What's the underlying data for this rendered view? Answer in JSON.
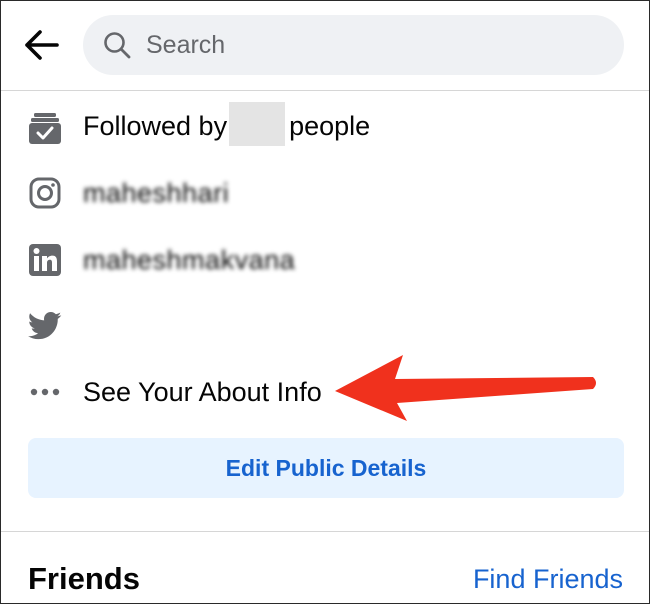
{
  "header": {
    "back_icon": "arrow-left-icon",
    "search": {
      "icon": "search-icon",
      "placeholder": "Search",
      "value": ""
    }
  },
  "info": {
    "followed": {
      "icon": "followers-check-icon",
      "prefix": "Followed by",
      "suffix": "people"
    },
    "instagram": {
      "icon": "instagram-icon",
      "handle": "maheshhari"
    },
    "linkedin": {
      "icon": "linkedin-icon",
      "handle": "maheshmakvana"
    },
    "twitter": {
      "icon": "twitter-icon"
    },
    "about": {
      "icon": "more-dots-icon",
      "label": "See Your About Info"
    }
  },
  "edit_button": {
    "label": "Edit Public Details"
  },
  "friends": {
    "title": "Friends",
    "find_label": "Find Friends"
  },
  "colors": {
    "accent": "#1763cf",
    "button_bg": "#e7f3ff",
    "icon_gray": "#65676b",
    "search_bg": "#eff1f4",
    "annotation_red": "#f0311d"
  }
}
